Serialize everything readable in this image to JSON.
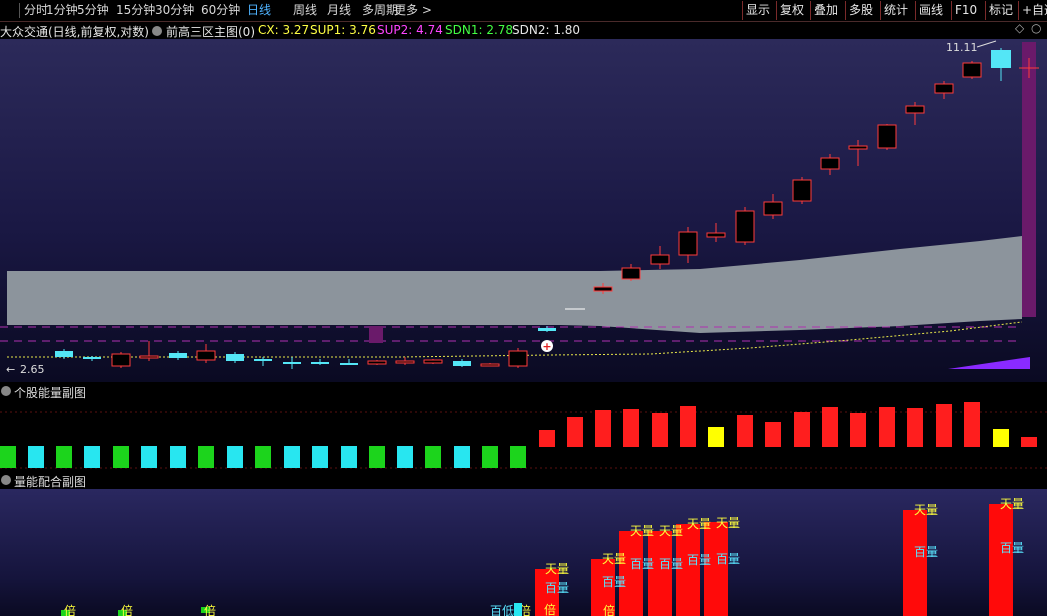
{
  "toolbar": {
    "period_tabs": [
      "分时",
      "1分钟",
      "5分钟",
      "15分钟",
      "30分钟",
      "60分钟",
      "日线",
      "周线",
      "月线",
      "多周期",
      "更多 >"
    ],
    "active_tab": "日线",
    "right_buttons": [
      "显示",
      "复权",
      "叠加",
      "多股",
      "统计",
      "画线",
      "F10",
      "标记",
      "+自选"
    ]
  },
  "infobar": {
    "stock_title": "大众交通(日线,前复权,对数)",
    "indicator_name": "前高三区主图(0)",
    "cx": "CX: 3.27",
    "sup1": "SUP1: 3.76",
    "sup2": "SUP2: 4.74",
    "sdn1": "SDN1: 2.78",
    "sdn2": "SDN2: 1.80"
  },
  "main_chart": {
    "high_label": "11.11",
    "low_label": "2.65",
    "colors": {
      "up": "#ff3b3b",
      "down": "#54e6f6",
      "band": "#8c949c",
      "ma": "#e8e84a"
    }
  },
  "sub1": {
    "title": "个股能量副图",
    "colors": {
      "green": "#1cd41c",
      "cyan": "#28e6f0",
      "red": "#ff1e1e",
      "yellow": "#ffff00"
    }
  },
  "sub2": {
    "title": "量能配合副图",
    "label_tian": "天量",
    "label_bai": "百量",
    "label_bei": "倍",
    "label_bai_di": "百低",
    "colors": {
      "bar": "#ff0a0a",
      "tian": "#ffff3c",
      "bai": "#5ae6ff"
    }
  }
}
